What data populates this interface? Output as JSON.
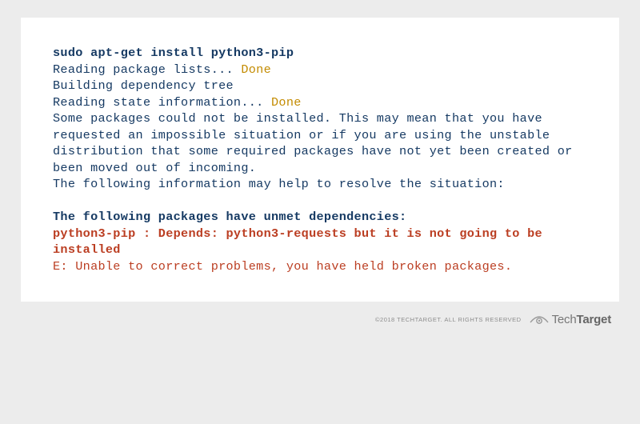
{
  "terminal": {
    "command": "sudo apt-get install python3-pip",
    "line_reading_pkg": "Reading package lists... ",
    "done": "Done",
    "line_building": "Building dependency tree",
    "line_reading_state": "Reading state information... ",
    "msg_cannot_install": "Some packages could not be installed. This may mean that you have requested an impossible situation or if you are using the unstable distribution that some required packages have not yet been created or been moved out of incoming.",
    "msg_help": "The following information may help to resolve the situation:",
    "unmet_header": "The following packages have unmet dependencies:",
    "depends_line": "python3-pip : Depends: python3-requests but it is not going to be installed",
    "error_line": "E: Unable to correct problems, you have held broken packages."
  },
  "footer": {
    "copyright": "©2018 TECHTARGET. ALL RIGHTS RESERVED",
    "brand_light": "Tech",
    "brand_bold": "Target"
  }
}
